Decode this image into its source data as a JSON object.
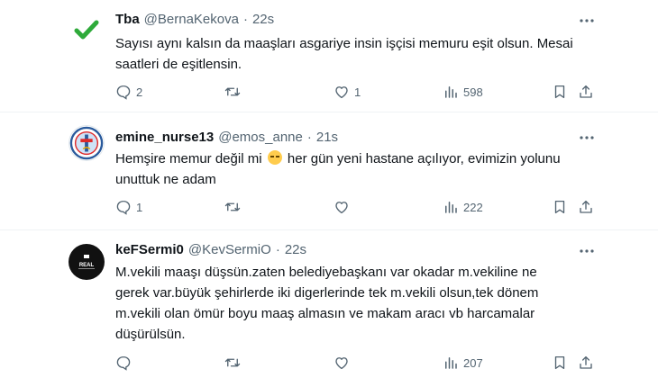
{
  "tweets": [
    {
      "display_name": "Tba",
      "handle": "@BernaKekova",
      "separator": "·",
      "time": "22s",
      "lines": [
        "Sayısı aynı kalsın da maaşları asgariye insin işçisi memuru eşit olsun. Mesai",
        "saatleri de eşitlensin."
      ],
      "reply_count": "2",
      "retweet_count": "",
      "like_count": "1",
      "view_count": "598",
      "avatar_icon": "green-checkmark-icon"
    },
    {
      "display_name": "emine_nurse13",
      "handle": "@emos_anne",
      "separator": "·",
      "time": "21s",
      "lines_before_emoji": "Hemşire memur değil mi",
      "lines_after_emoji": "her gün yeni hastane açılıyor, evimizin yolunu",
      "line2": "unuttuk ne adam",
      "emoji_name": "pensive-face-emoji",
      "reply_count": "1",
      "retweet_count": "",
      "like_count": "",
      "view_count": "222",
      "avatar_icon": "nursing-emblem-icon"
    },
    {
      "display_name": "keFSermi0",
      "handle": "@KevSermiO",
      "separator": "·",
      "time": "22s",
      "lines": [
        "M.vekili maaşı düşsün.zaten belediyebaşkanı var okadar m.vekiline ne",
        "gerek var.büyük şehirlerde iki digerlerinde tek m.vekili olsun,tek dönem",
        "m.vekili olan ömür boyu maaş almasın ve makam aracı vb harcamalar",
        "düşürülsün."
      ],
      "reply_count": "",
      "retweet_count": "",
      "like_count": "",
      "view_count": "207",
      "avatar_text": "REAL",
      "avatar_icon": "real-logo-icon"
    }
  ],
  "colors": {
    "text": "#0f1419",
    "secondary": "#536471",
    "check_green": "#2eaa3a"
  }
}
